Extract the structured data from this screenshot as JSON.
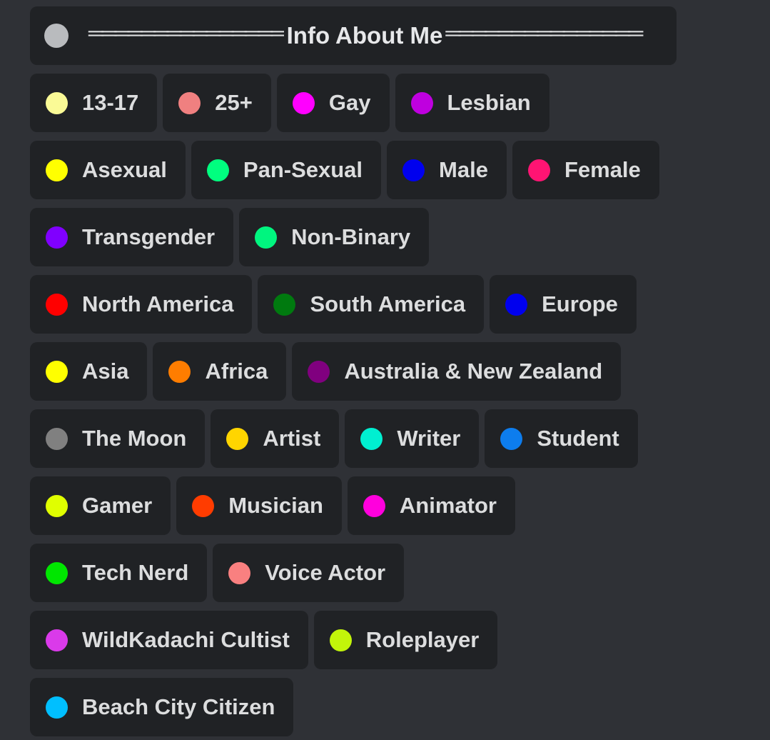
{
  "header": {
    "title": "Info About Me",
    "dot_color": "#b9bbbe",
    "rule_left": "═══════════════",
    "rule_right": "═══════════════"
  },
  "theme": {
    "page_background": "#2f3136",
    "card_background": "#202225",
    "text_color": "#dcddde"
  },
  "rows": [
    [
      {
        "label": "13-17",
        "color": "#fafa96"
      },
      {
        "label": "25+",
        "color": "#f08080"
      },
      {
        "label": "Gay",
        "color": "#ff00ff"
      },
      {
        "label": "Lesbian",
        "color": "#bf00df"
      }
    ],
    [
      {
        "label": "Asexual",
        "color": "#ffff00"
      },
      {
        "label": "Pan-Sexual",
        "color": "#00ff7f"
      },
      {
        "label": "Male",
        "color": "#0000ee"
      },
      {
        "label": "Female",
        "color": "#ff1473"
      }
    ],
    [
      {
        "label": "Transgender",
        "color": "#8000ff"
      },
      {
        "label": "Non-Binary",
        "color": "#00f57f"
      }
    ],
    [
      {
        "label": "North America",
        "color": "#ff0000"
      },
      {
        "label": "South America",
        "color": "#007a0f"
      },
      {
        "label": "Europe",
        "color": "#0000ee"
      }
    ],
    [
      {
        "label": "Asia",
        "color": "#ffff00"
      },
      {
        "label": "Africa",
        "color": "#ff7d00"
      },
      {
        "label": "Australia & New Zealand",
        "color": "#80007f"
      }
    ],
    [
      {
        "label": "The Moon",
        "color": "#808080"
      },
      {
        "label": "Artist",
        "color": "#ffd500"
      },
      {
        "label": "Writer",
        "color": "#00efd1"
      },
      {
        "label": "Student",
        "color": "#0d7dee"
      }
    ],
    [
      {
        "label": "Gamer",
        "color": "#e0ff00"
      },
      {
        "label": "Musician",
        "color": "#ff3c00"
      },
      {
        "label": "Animator",
        "color": "#ff00dd"
      }
    ],
    [
      {
        "label": "Tech Nerd",
        "color": "#00e600"
      },
      {
        "label": "Voice Actor",
        "color": "#f98080"
      }
    ],
    [
      {
        "label": "WildKadachi Cultist",
        "color": "#da3aea"
      },
      {
        "label": "Roleplayer",
        "color": "#c2f50a"
      }
    ],
    [
      {
        "label": "Beach City Citizen",
        "color": "#00bfff"
      }
    ]
  ]
}
